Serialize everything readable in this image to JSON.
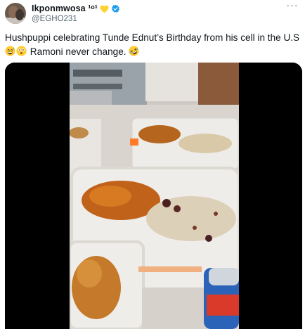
{
  "author": {
    "display_name": "Ikponmwosa ¹ᵒ¹",
    "handle": "@EGHO231"
  },
  "icons": {
    "avatar": "profile-photo",
    "badge_heart": "yellow-heart-icon",
    "verified": "verified-badge-icon",
    "more": "more-options-icon"
  },
  "tweet": {
    "line1": "Hushpuppi celebrating Tunde Ednut’s Birthday from his cell in the U.S",
    "line2_text": "Ramoni never change.",
    "emoji_before": [
      "grinning-sweat-emoji",
      "flushed-emoji"
    ],
    "emoji_after": [
      "rolling-laughing-emoji"
    ]
  },
  "media": {
    "type": "video",
    "description_icon": "video-thumbnail"
  },
  "colors": {
    "text": "#0f1419",
    "secondary": "#536471",
    "verified": "#1d9bf0",
    "heart": "#ffd233"
  }
}
